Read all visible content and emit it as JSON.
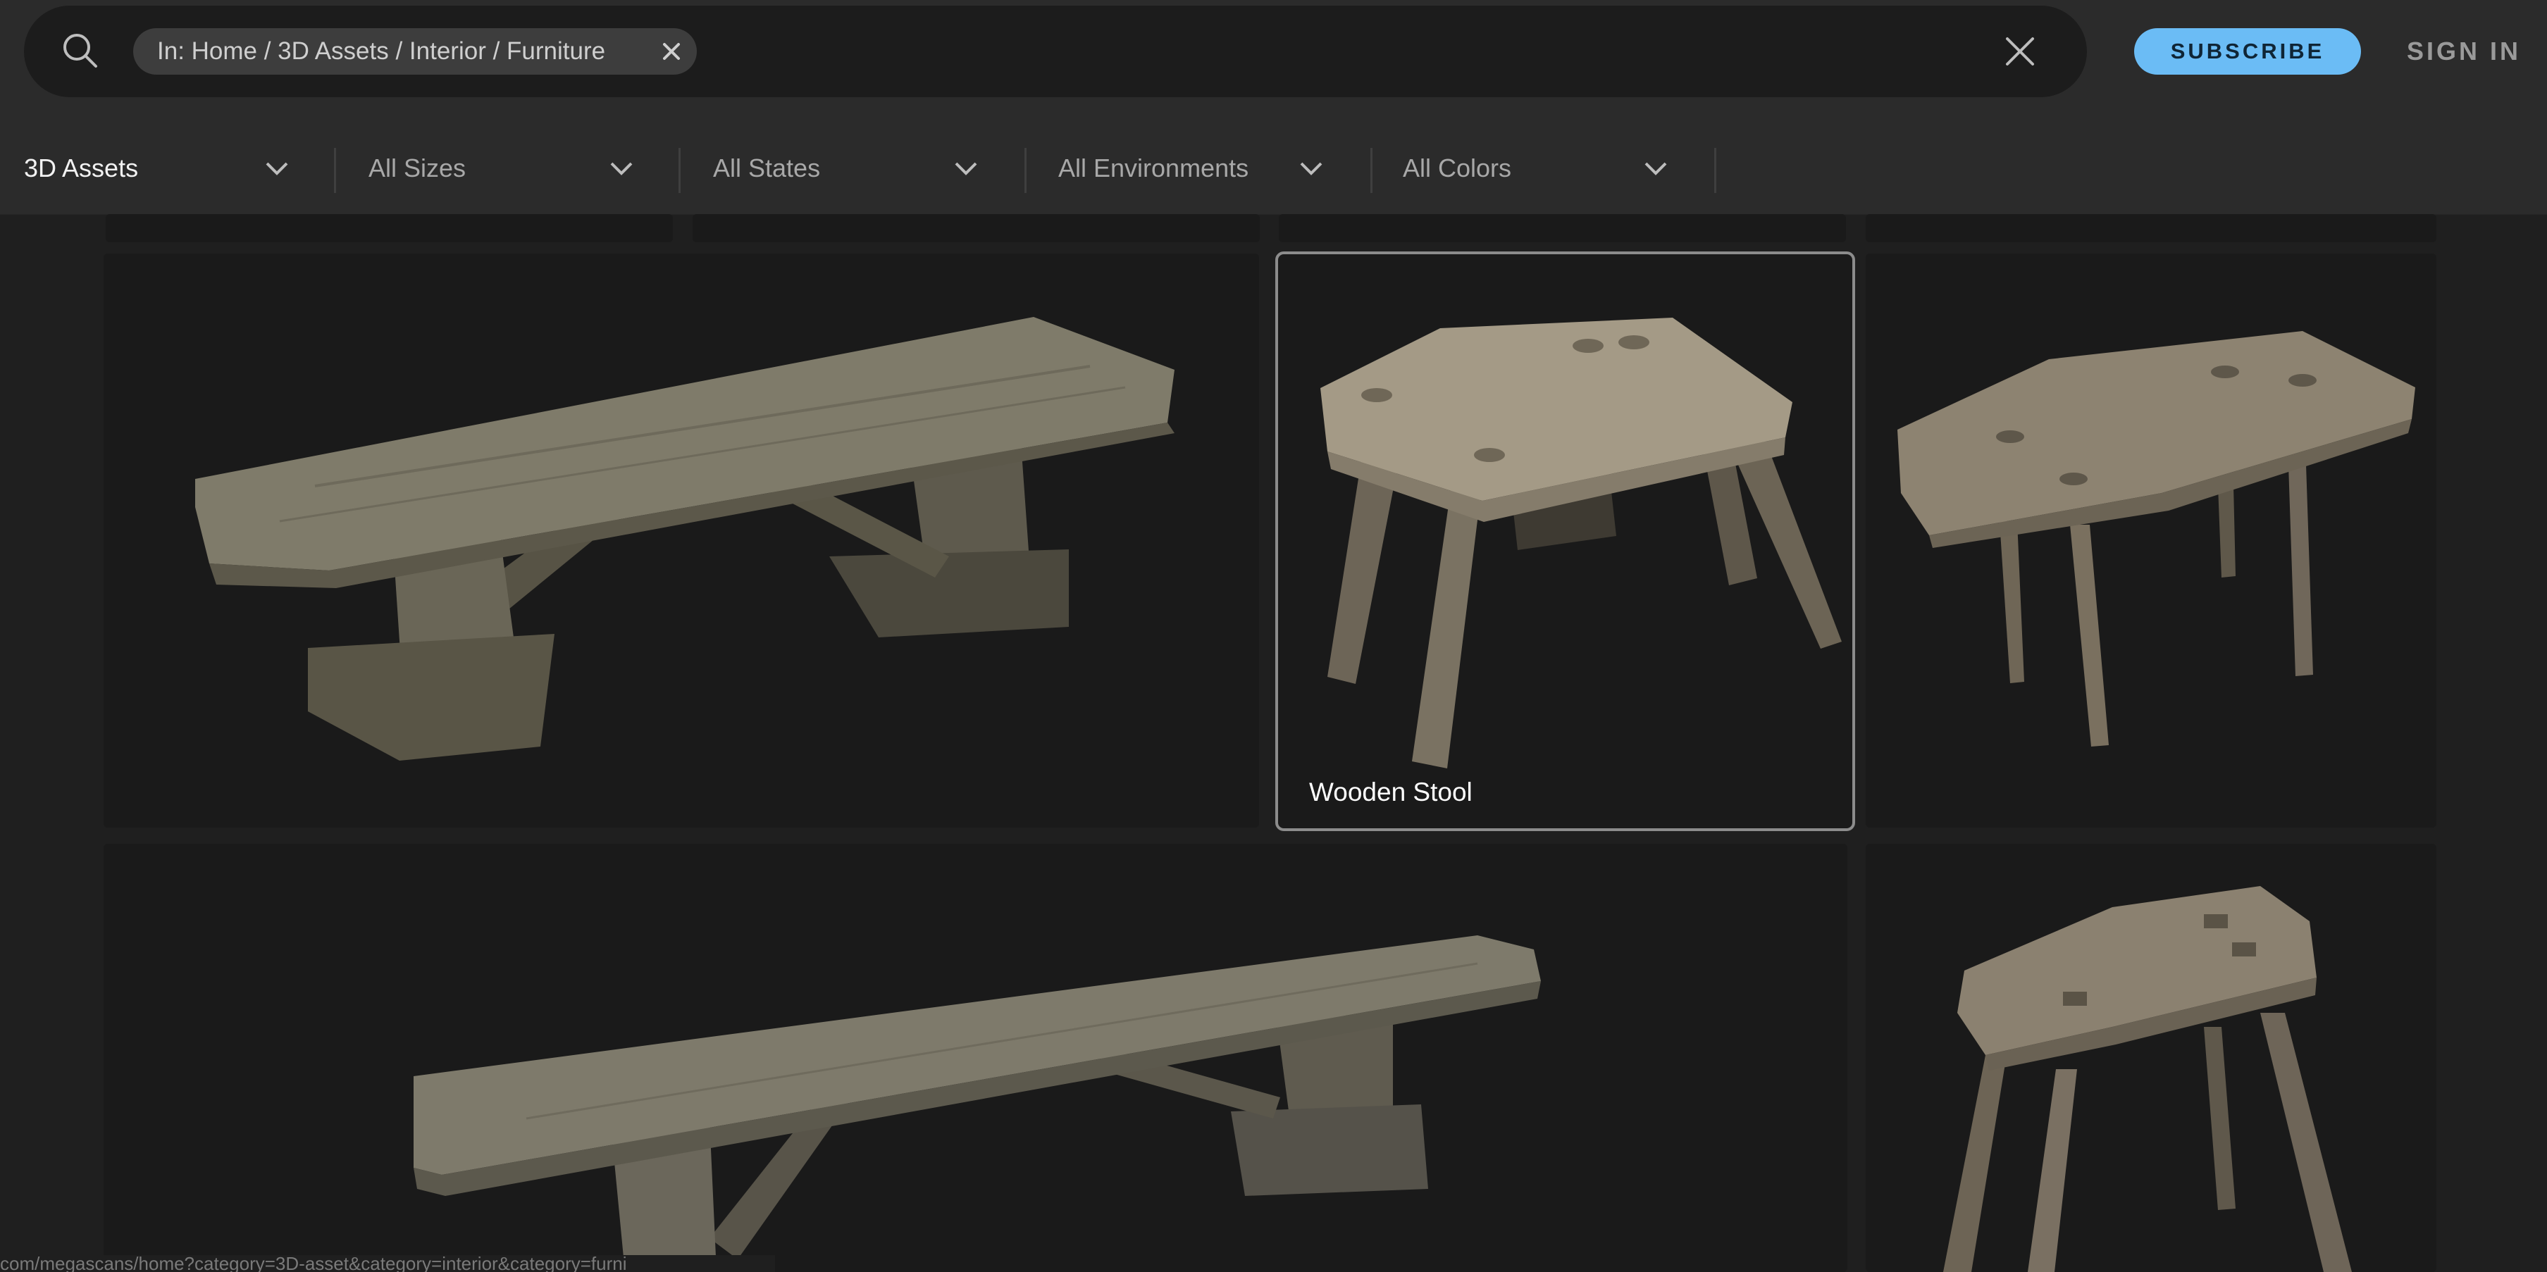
{
  "search": {
    "chip_label": "In: Home / 3D Assets / Interior / Furniture"
  },
  "header": {
    "subscribe_label": "SUBSCRIBE",
    "signin_label": "SIGN IN"
  },
  "filters": [
    {
      "label": "3D Assets"
    },
    {
      "label": "All Sizes"
    },
    {
      "label": "All States"
    },
    {
      "label": "All Environments"
    },
    {
      "label": "All Colors"
    }
  ],
  "grid": {
    "hovered_card_title": "Wooden Stool"
  },
  "status_bar": {
    "url": "com/megascans/home?category=3D-asset&category=interior&category=furni"
  },
  "icons": {
    "search": "search-icon",
    "chip_close": "close-icon",
    "clear": "clear-icon",
    "dropdown": "chevron-down-icon"
  },
  "colors": {
    "accent": "#6bbcf5",
    "background": "#1f1f1f",
    "bar": "#2b2b2b"
  }
}
